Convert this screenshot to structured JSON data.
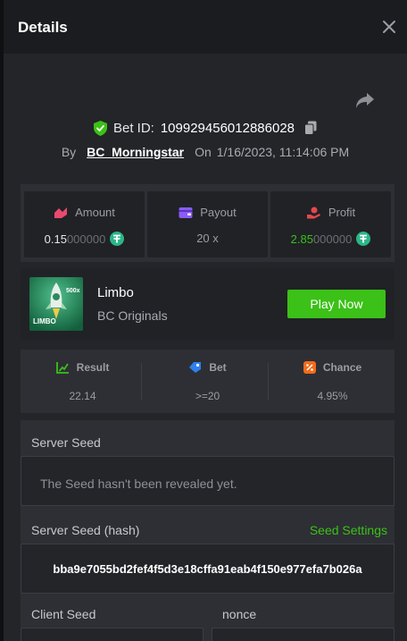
{
  "header": {
    "title": "Details"
  },
  "bet": {
    "id_label": "Bet ID:",
    "id": "109929456012886028",
    "by_label": "By",
    "user": "BC_Morningstar",
    "on_label": "On",
    "datetime": "1/16/2023, 11:14:06 PM"
  },
  "stats": {
    "amount": {
      "label": "Amount",
      "value_main": "0.15",
      "value_rest": "000000"
    },
    "payout": {
      "label": "Payout",
      "value": "20 x"
    },
    "profit": {
      "label": "Profit",
      "value_main": "2.85",
      "value_rest": "000000"
    }
  },
  "game": {
    "name": "Limbo",
    "provider": "BC Originals",
    "play_label": "Play Now",
    "thumb_badge": "500x",
    "thumb_logo": "LIMBO"
  },
  "limbo": {
    "result": {
      "label": "Result",
      "value": "22.14"
    },
    "bet": {
      "label": "Bet",
      "value": ">=20"
    },
    "chance": {
      "label": "Chance",
      "value": "4.95%"
    }
  },
  "seeds": {
    "server_seed_label": "Server Seed",
    "server_seed_value": "The Seed hasn't been revealed yet.",
    "server_hash_label": "Server Seed (hash)",
    "seed_settings_label": "Seed Settings",
    "server_hash_value": "bba9e7055bd2fef4f5d3e18cffa91eab4f150e977efa7b026a",
    "client_seed_label": "Client Seed",
    "nonce_label": "nonce"
  },
  "colors": {
    "accent_green": "#3bc117",
    "amount_icon": "#e84a6e",
    "payout_icon": "#8b5cf6",
    "profit_icon": "#e5484d",
    "bet_icon": "#2f80ed",
    "chance_icon": "#f26b1d",
    "token": "#2cb588"
  }
}
